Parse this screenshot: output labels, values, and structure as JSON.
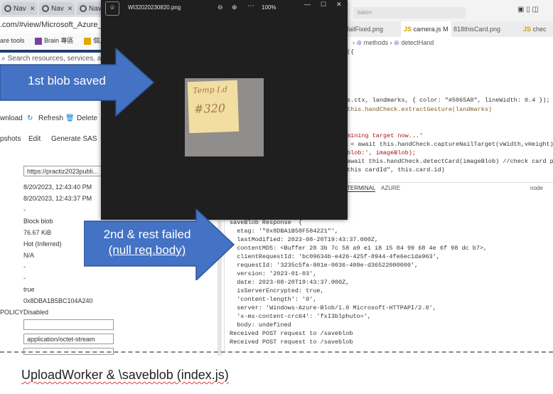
{
  "browser": {
    "tabs": [
      {
        "label": "Nav"
      },
      {
        "label": "Nav"
      },
      {
        "label": "Nav"
      }
    ],
    "address": ".com/#view/Microsoft_Azure_Sto...",
    "bookmarks": [
      "are tools",
      "Brain 專區",
      "個人重點"
    ],
    "search_placeholder": "Search resources, services, and docs"
  },
  "azure": {
    "commands": {
      "download": "wnload",
      "refresh": "Refresh",
      "delete": "Delete"
    },
    "tabs": [
      "pshots",
      "Edit",
      "Generate SAS"
    ],
    "url_value": "https://practiz2023publi...",
    "props": [
      "8/20/2023, 12:43:40 PM",
      "8/20/2023, 12:43:37 PM",
      "-",
      "Block blob",
      "76.67 KiB",
      "Hot (Inferred)",
      "N/A",
      "-",
      "-",
      "true",
      "0x8DBA1B5BC104A240"
    ],
    "policy_label": "POLICY",
    "policy_value": "Disabled",
    "content_type": "application/octet-stream"
  },
  "vscode": {
    "search": "baton",
    "tabs": [
      "failFixed.png",
      "camera.js M",
      "818thisCard.png",
      "chec"
    ],
    "breadcrumb": [
      "methods",
      "detectHand"
    ],
    "code": [
      "({",
      "",
      "",
      "",
      "s.ctx, landmarks, { color: \"#5065A8\", lineWidth: 0.4 });",
      "this.handCheck.extractGesture(landmarks)",
      "",
      "",
      "mining target now...'",
      " = await this.handCheck.captureNailTarget(vWidth,vHeight)",
      "blob:', imageBlob);",
      "await this.handCheck.detectCard(imageBlob) //check card pr",
      "this cardId\", this.card.id)"
    ],
    "panel_tabs": [
      "TERMINAL",
      "AZURE",
      "node"
    ],
    "terminal": [
      "saveBlob Response  {",
      "  etag: '\"0x8DBA1B58F584221\"',",
      "  lastModified: 2023-08-20T19:43:37.000Z,",
      "  contentMD5: <Buffer 28 3b 7c 58 a9 e1 18 15 84 99 68 4e 6f 98 dc b7>,",
      "  clientRequestId: 'bc09634b-e426-425f-8944-4fe6ec1da963',",
      "  requestId: '3235c5fa-801e-0036-409e-d36522000000',",
      "  version: '2023-01-03',",
      "  date: 2023-08-20T19:43:37.000Z,",
      "  isServerEncrypted: true,",
      "  'content-length': '0',",
      "  server: 'Windows-Azure-Blob/1.0 Microsoft-HTTPAPI/2.0',",
      "  'x-ms-content-crc64': 'fxI3blphuto=',",
      "  body: undefined",
      "}",
      "Received POST request to /saveblob",
      "Received POST request to /saveblob"
    ]
  },
  "viewer": {
    "filename": "WI32020230820.png",
    "zoom": "100%",
    "note_line1": "Temp I.d",
    "note_line2": "#320"
  },
  "annotations": {
    "arrow1": "1st blob saved",
    "arrow2_line1": "2nd & rest failed",
    "arrow2_line2": "(null req.body)",
    "footer": "UploadWorker & \\saveblob (index.js)"
  },
  "colors": {
    "arrow": "#4472c4",
    "arrow_border": "#2f5597",
    "azure_bar": "#1f3e6f",
    "viewer_bg": "#1f1f1f"
  }
}
